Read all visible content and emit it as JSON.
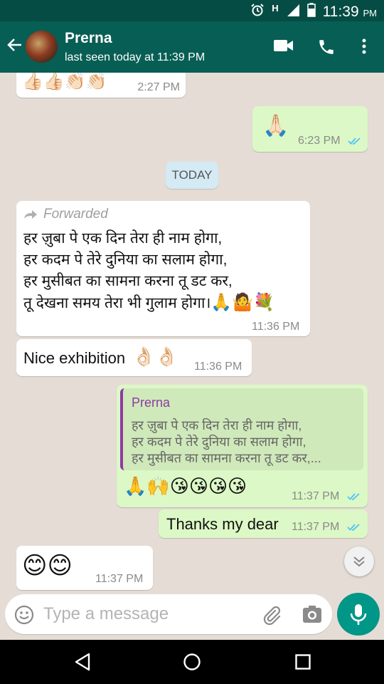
{
  "status_bar": {
    "network": "H",
    "time": "11:39",
    "ampm": "PM"
  },
  "header": {
    "name": "Prerna",
    "last_seen": "last seen today at 11:39 PM"
  },
  "messages": {
    "m0": {
      "emoji": "👍🏻👍🏻👏🏻👏🏻",
      "time": "2:27 PM"
    },
    "m1": {
      "emoji": "🙏🏻",
      "time": "6:23 PM"
    },
    "date": "TODAY",
    "m2": {
      "forwarded_label": "Forwarded",
      "lines": [
        "हर ज़ुबा पे एक दिन तेरा ही नाम होगा,",
        "हर कदम पे तेरे दुनिया का सलाम होगा,",
        "हर मुसीबत का सामना करना तू डट कर,",
        "तू देखना समय तेरा भी गुलाम होगा।"
      ],
      "trailing_emoji": "🙏🤷💐",
      "time": "11:36 PM"
    },
    "m3": {
      "text": "Nice exhibition",
      "emoji": "👌🏻👌🏻",
      "time": "11:36 PM"
    },
    "m4": {
      "quote_name": "Prerna",
      "quote_lines": [
        "हर ज़ुबा पे एक दिन तेरा ही नाम होगा,",
        "हर कदम पे तेरे दुनिया का सलाम होगा,",
        "हर मुसीबत का सामना करना तू डट कर,..."
      ],
      "emoji": "🙏🙌😘😘😘😘",
      "time": "11:37 PM"
    },
    "m5": {
      "text": "Thanks my dear",
      "time": "11:37 PM"
    },
    "m6": {
      "emoji": "😊😊",
      "time": "11:37 PM"
    }
  },
  "input": {
    "placeholder": "Type a message"
  },
  "colors": {
    "header": "#075e54",
    "status_bar": "#054d44",
    "outgoing_bubble": "#dcf8c6",
    "incoming_bubble": "#ffffff",
    "read_ticks": "#4fc3f7",
    "accent": "#009688",
    "quote_author": "#8e3aa5"
  },
  "icons": {
    "status": [
      "alarm-icon",
      "signal-icon",
      "battery-icon"
    ],
    "header": [
      "back-arrow-icon",
      "video-call-icon",
      "voice-call-icon",
      "more-options-icon"
    ],
    "input": [
      "emoji-icon",
      "attach-icon",
      "camera-icon",
      "mic-icon"
    ],
    "nav": [
      "nav-back-icon",
      "nav-home-icon",
      "nav-recents-icon"
    ]
  }
}
